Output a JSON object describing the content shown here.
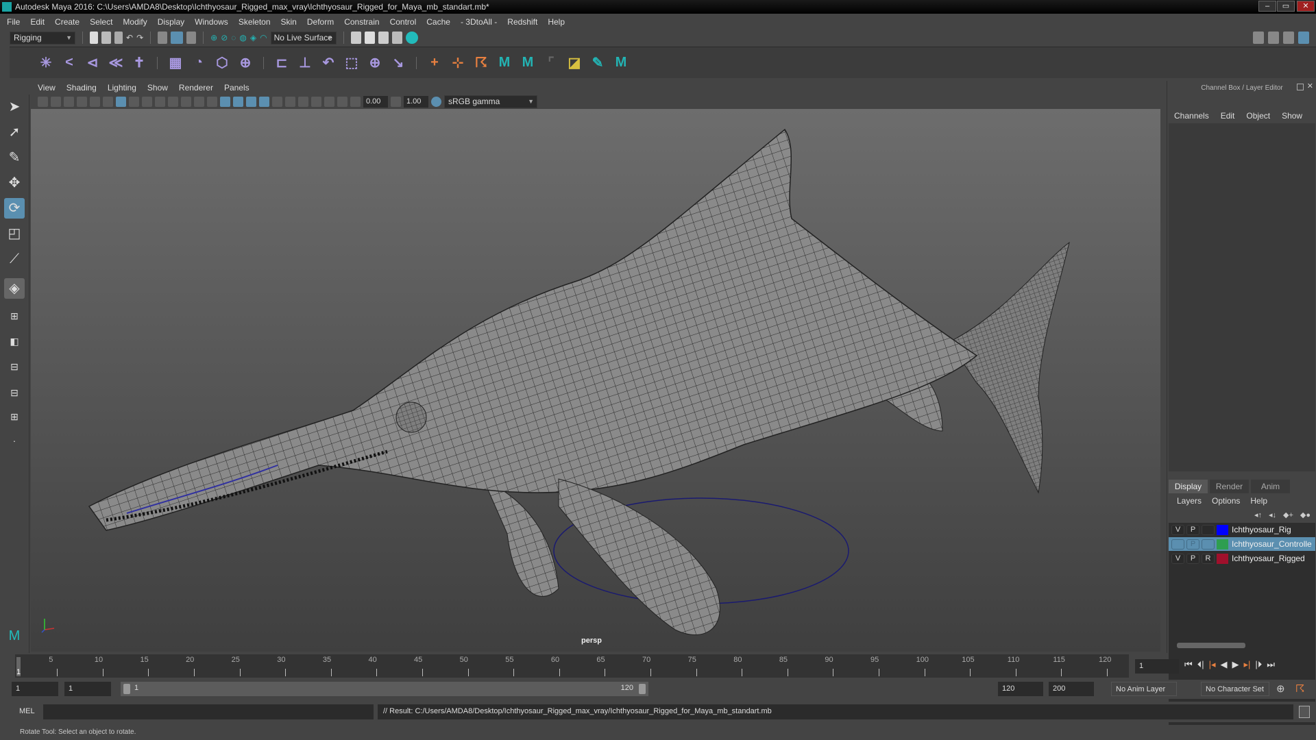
{
  "window": {
    "title": "Autodesk Maya 2016: C:\\Users\\AMDA8\\Desktop\\Ichthyosaur_Rigged_max_vray\\Ichthyosaur_Rigged_for_Maya_mb_standart.mb*",
    "min": "–",
    "max": "▭",
    "close": "✕"
  },
  "menubar": [
    "File",
    "Edit",
    "Create",
    "Select",
    "Modify",
    "Display",
    "Windows",
    "Skeleton",
    "Skin",
    "Deform",
    "Constrain",
    "Control",
    "Cache",
    "- 3DtoAll -",
    "Redshift",
    "Help"
  ],
  "statusline": {
    "mode": "Rigging",
    "live_surface": "No Live Surface"
  },
  "viewport": {
    "menu": [
      "View",
      "Shading",
      "Lighting",
      "Show",
      "Renderer",
      "Panels"
    ],
    "exposure": "0.00",
    "gamma": "1.00",
    "color_space": "sRGB gamma",
    "camera_label": "persp"
  },
  "channel_box": {
    "title": "Channel Box / Layer Editor",
    "menu": [
      "Channels",
      "Edit",
      "Object",
      "Show"
    ]
  },
  "layer_editor": {
    "tabs": [
      "Display",
      "Render",
      "Anim"
    ],
    "menu": [
      "Layers",
      "Options",
      "Help"
    ],
    "layers": [
      {
        "v": "V",
        "p": "P",
        "r": "",
        "name": "Ichthyosaur_Rig",
        "color": "#0000ff",
        "selected": false
      },
      {
        "v": "",
        "p": "P",
        "r": "",
        "name": "Ichthyosaur_Controlle",
        "color": "#2e9e50",
        "selected": true
      },
      {
        "v": "V",
        "p": "P",
        "r": "R",
        "name": "Ichthyosaur_Rigged",
        "color": "#a0102c",
        "selected": false
      }
    ]
  },
  "timeline": {
    "ticks": [
      "5",
      "10",
      "15",
      "20",
      "25",
      "30",
      "35",
      "40",
      "45",
      "50",
      "55",
      "60",
      "65",
      "70",
      "75",
      "80",
      "85",
      "90",
      "95",
      "100",
      "105",
      "110",
      "115",
      "120"
    ],
    "current_frame": "1",
    "current_frame_field": "1"
  },
  "range": {
    "start": "1",
    "anim_start": "1",
    "slider_start": "1",
    "slider_end": "120",
    "end": "120",
    "anim_end": "200",
    "anim_layer": "No Anim Layer",
    "character_set": "No Character Set"
  },
  "command": {
    "lang": "MEL",
    "result": "// Result: C:/Users/AMDA8/Desktop/Ichthyosaur_Rigged_max_vray/Ichthyosaur_Rigged_for_Maya_mb_standart.mb"
  },
  "status": "Rotate Tool: Select an object to rotate."
}
